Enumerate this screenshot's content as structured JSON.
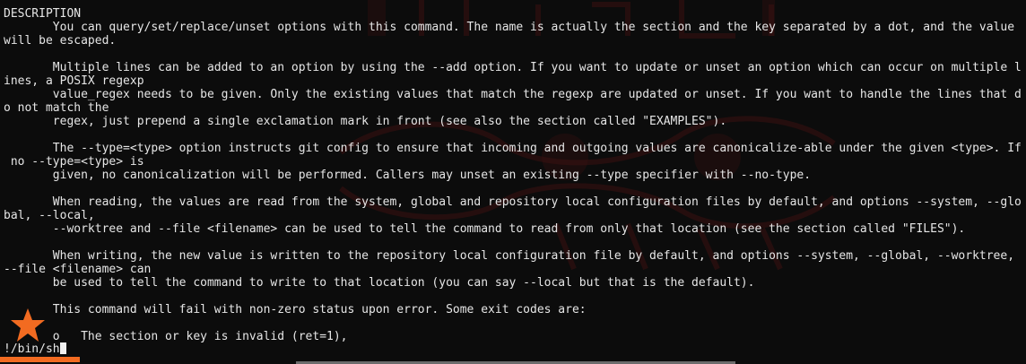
{
  "terminal": {
    "lines": [
      "DESCRIPTION",
      "       You can query/set/replace/unset options with this command. The name is actually the section and the key separated by a dot, and the value",
      "will be escaped.",
      "",
      "       Multiple lines can be added to an option by using the --add option. If you want to update or unset an option which can occur on multiple l",
      "ines, a POSIX regexp",
      "       value_regex needs to be given. Only the existing values that match the regexp are updated or unset. If you want to handle the lines that d",
      "o not match the",
      "       regex, just prepend a single exclamation mark in front (see also the section called \"EXAMPLES\").",
      "",
      "       The --type=<type> option instructs git config to ensure that incoming and outgoing values are canonicalize-able under the given <type>. If",
      " no --type=<type> is",
      "       given, no canonicalization will be performed. Callers may unset an existing --type specifier with --no-type.",
      "",
      "       When reading, the values are read from the system, global and repository local configuration files by default, and options --system, --glo",
      "bal, --local,",
      "       --worktree and --file <filename> can be used to tell the command to read from only that location (see the section called \"FILES\").",
      "",
      "       When writing, the new value is written to the repository local configuration file by default, and options --system, --global, --worktree,",
      "--file <filename> can",
      "       be used to tell the command to write to that location (you can say --local but that is the default).",
      "",
      "       This command will fail with non-zero status upon error. Some exit codes are:",
      "",
      "       o   The section or key is invalid (ret=1),"
    ],
    "prompt": "!/bin/sh"
  },
  "icons": {
    "badge": "star-icon",
    "cursor": "block-cursor"
  },
  "colors": {
    "background": "#0c0c0c",
    "text": "#e6e6e6",
    "accent": "#f26b21",
    "wallpaper_red": "#5a1414"
  }
}
